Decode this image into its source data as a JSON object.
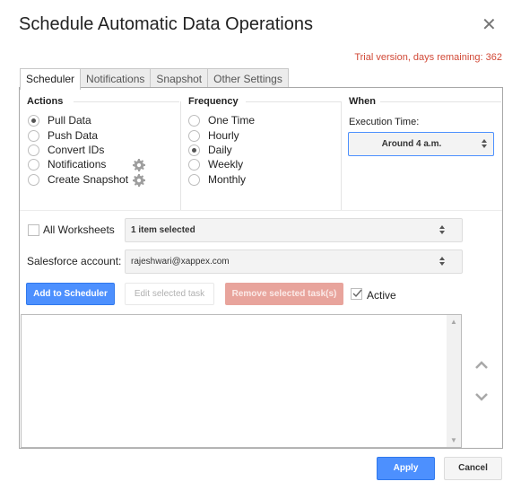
{
  "dialog": {
    "title": "Schedule Automatic Data Operations",
    "close_icon": "close-icon",
    "trial_notice": "Trial version, days remaining: 362",
    "accent_color": "#4d90fe",
    "trial_color": "#d14836"
  },
  "tabs": [
    {
      "label": "Scheduler",
      "active": true
    },
    {
      "label": "Notifications",
      "active": false
    },
    {
      "label": "Snapshot",
      "active": false
    },
    {
      "label": "Other Settings",
      "active": false
    }
  ],
  "actions": {
    "title": "Actions",
    "options": [
      {
        "label": "Pull Data",
        "checked": true,
        "gear": false
      },
      {
        "label": "Push Data",
        "checked": false,
        "gear": false
      },
      {
        "label": "Convert IDs",
        "checked": false,
        "gear": false
      },
      {
        "label": "Notifications",
        "checked": false,
        "gear": true
      },
      {
        "label": "Create Snapshot",
        "checked": false,
        "gear": true
      }
    ]
  },
  "frequency": {
    "title": "Frequency",
    "options": [
      {
        "label": "One Time",
        "checked": false
      },
      {
        "label": "Hourly",
        "checked": false
      },
      {
        "label": "Daily",
        "checked": true
      },
      {
        "label": "Weekly",
        "checked": false
      },
      {
        "label": "Monthly",
        "checked": false
      }
    ]
  },
  "when": {
    "title": "When",
    "execution_label": "Execution Time:",
    "execution_value": "Around 4 a.m."
  },
  "worksheets": {
    "all_label": "All Worksheets",
    "all_checked": false,
    "selection": "1 item selected"
  },
  "account": {
    "label": "Salesforce account:",
    "value": "rajeshwari@xappex.com"
  },
  "task_buttons": {
    "add": "Add to Scheduler",
    "edit": "Edit selected task",
    "remove": "Remove selected task(s)",
    "active_label": "Active",
    "active_checked": true
  },
  "task_list": {
    "items": []
  },
  "footer": {
    "apply": "Apply",
    "cancel": "Cancel"
  }
}
